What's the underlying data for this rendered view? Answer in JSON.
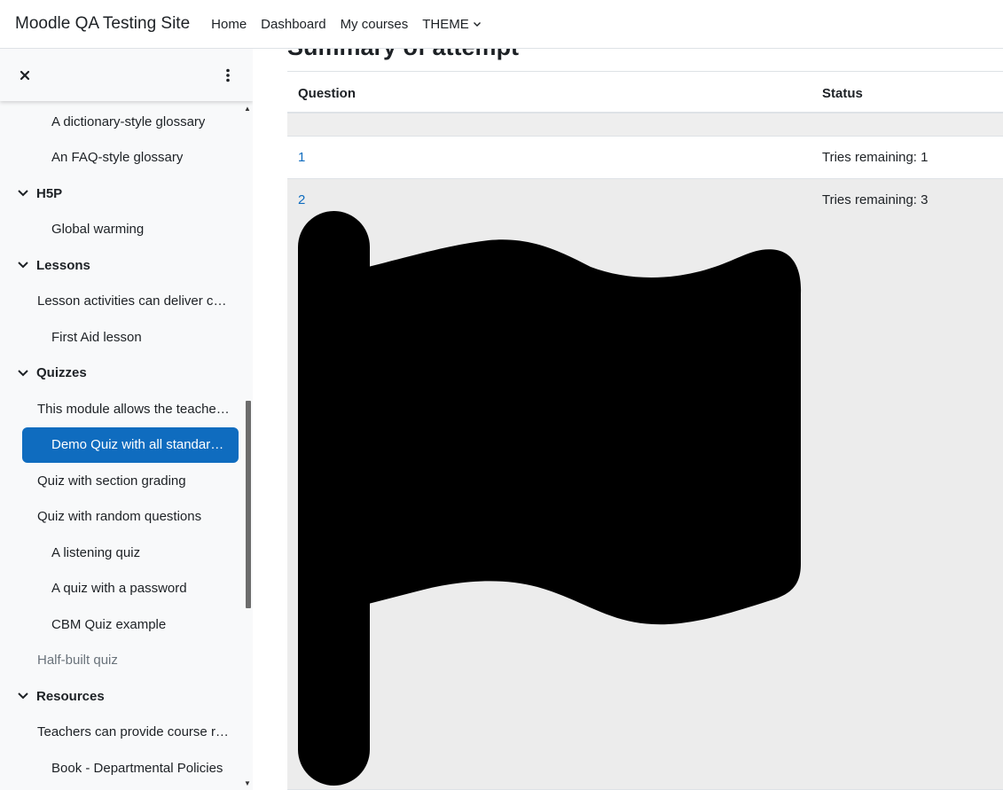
{
  "navbar": {
    "brand": "Moodle QA Testing Site",
    "links": [
      "Home",
      "Dashboard",
      "My courses",
      "THEME"
    ]
  },
  "drawer": {
    "items": [
      {
        "label": "A dictionary-style glossary",
        "type": "activity"
      },
      {
        "label": "An FAQ-style glossary",
        "type": "activity"
      },
      {
        "label": "H5P",
        "type": "section"
      },
      {
        "label": "Global warming",
        "type": "activity"
      },
      {
        "label": "Lessons",
        "type": "section"
      },
      {
        "label": "Lesson activities can deliver co…",
        "type": "label"
      },
      {
        "label": "First Aid lesson",
        "type": "activity"
      },
      {
        "label": "Quizzes",
        "type": "section"
      },
      {
        "label": "This module allows the teache…",
        "type": "label"
      },
      {
        "label": "Demo Quiz with all standard …",
        "type": "active"
      },
      {
        "label": "Quiz with section grading",
        "type": "label"
      },
      {
        "label": "Quiz with random questions",
        "type": "label"
      },
      {
        "label": "A listening quiz",
        "type": "activity"
      },
      {
        "label": "A quiz with a password",
        "type": "activity"
      },
      {
        "label": "CBM Quiz example",
        "type": "activity"
      },
      {
        "label": "Half-built quiz",
        "type": "dim"
      },
      {
        "label": "Resources",
        "type": "section"
      },
      {
        "label": "Teachers can provide course r…",
        "type": "label"
      },
      {
        "label": "Book - Departmental Policies",
        "type": "activity"
      }
    ]
  },
  "main": {
    "title": "Summary of attempt",
    "table": {
      "headers": [
        "Question",
        "Status"
      ],
      "rows": [
        {
          "question": "1",
          "status": "Tries remaining: 1"
        },
        {
          "question": "2",
          "status": "Tries remaining: 3"
        }
      ]
    }
  },
  "colors": {
    "accent": "#0f6cbf",
    "drawer_bg": "#f8f9fa",
    "row_highlight": "#ececec"
  },
  "icons": [
    "close-icon",
    "more-vertical-icon",
    "chevron-down-icon",
    "flag-icon"
  ]
}
